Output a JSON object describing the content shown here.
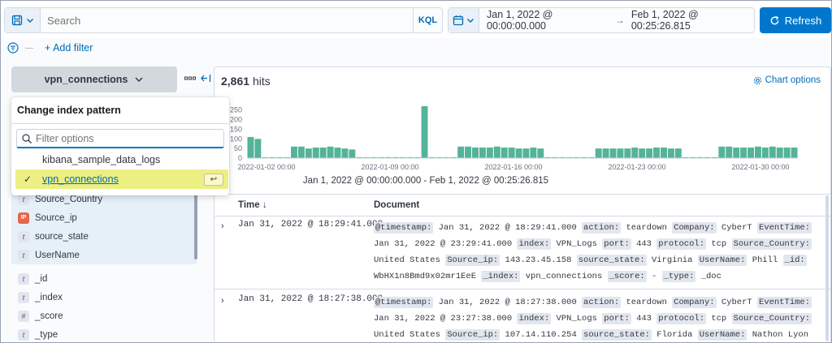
{
  "query_bar": {
    "placeholder": "Search",
    "language_label": "KQL",
    "saved_query_icon": "save-icon"
  },
  "date_picker": {
    "start": "Jan 1, 2022 @ 00:00:00.000",
    "arrow": "→",
    "end": "Feb 1, 2022 @ 00:25:26.815",
    "icon": "calendar-icon"
  },
  "refresh_label": "Refresh",
  "add_filter_label": "+ Add filter",
  "index_pattern": {
    "selected": "vpn_connections",
    "popover": {
      "title": "Change index pattern",
      "filter_placeholder": "Filter options",
      "options": [
        {
          "label": "kibana_sample_data_logs",
          "selected": false
        },
        {
          "label": "vpn_connections",
          "selected": true
        }
      ],
      "enter_key": "↩"
    }
  },
  "fields": {
    "selected_group": [
      {
        "type": "t",
        "name": "Source_Country"
      },
      {
        "type": "IP",
        "name": "Source_ip"
      },
      {
        "type": "t",
        "name": "source_state"
      },
      {
        "type": "t",
        "name": "UserName"
      }
    ],
    "meta": [
      {
        "type": "t",
        "name": "_id"
      },
      {
        "type": "t",
        "name": "_index"
      },
      {
        "type": "#",
        "name": "_score"
      },
      {
        "type": "t",
        "name": "_type"
      }
    ]
  },
  "hits": {
    "count": "2,861",
    "label": "hits"
  },
  "chart_options_label": "Chart options",
  "chart_range_label": "Jan 1, 2022 @ 00:00:00.000 - Feb 1, 2022 @ 00:25:26.815",
  "chart_data": {
    "type": "bar",
    "color": "#54b399",
    "y_ticks": [
      "250",
      "200",
      "150",
      "100",
      "50",
      "0"
    ],
    "ylim": [
      0,
      270
    ],
    "x_ticks": [
      "2022-01-02 00:00",
      "2022-01-09 00:00",
      "2022-01-16 00:00",
      "2022-01-23 00:00",
      "2022-01-30 00:00"
    ],
    "values": [
      110,
      100,
      5,
      5,
      5,
      5,
      60,
      60,
      50,
      55,
      55,
      60,
      55,
      50,
      45,
      5,
      5,
      5,
      5,
      5,
      5,
      5,
      5,
      5,
      270,
      5,
      5,
      5,
      5,
      60,
      60,
      55,
      55,
      55,
      60,
      55,
      55,
      50,
      50,
      55,
      50,
      5,
      5,
      5,
      5,
      5,
      5,
      5,
      50,
      50,
      50,
      50,
      50,
      55,
      50,
      50,
      55,
      55,
      50,
      50,
      5,
      5,
      5,
      5,
      5,
      60,
      60,
      55,
      55,
      55,
      60,
      55,
      60,
      55,
      55,
      55
    ]
  },
  "table": {
    "col_time": "Time ↓",
    "col_document": "Document",
    "rows": [
      {
        "time": "Jan 31, 2022 @ 18:29:41.000",
        "fields": [
          [
            "@timestamp:",
            "Jan 31, 2022 @ 18:29:41.000"
          ],
          [
            "action:",
            "teardown"
          ],
          [
            "Company:",
            "CyberT"
          ],
          [
            "EventTime:",
            "Jan 31, 2022 @ 23:29:41.000"
          ],
          [
            "index:",
            "VPN_Logs"
          ],
          [
            "port:",
            "443"
          ],
          [
            "protocol:",
            "tcp"
          ],
          [
            "Source_Country:",
            "United States"
          ],
          [
            "Source_ip:",
            "143.23.45.158"
          ],
          [
            "source_state:",
            "Virginia"
          ],
          [
            "UserName:",
            "Phill"
          ],
          [
            "_id:",
            "WbHX1n8Bmd9x02mr1EeE"
          ],
          [
            "_index:",
            "vpn_connections"
          ],
          [
            "_score:",
            " - "
          ],
          [
            "_type:",
            "_doc"
          ]
        ]
      },
      {
        "time": "Jan 31, 2022 @ 18:27:38.000",
        "fields": [
          [
            "@timestamp:",
            "Jan 31, 2022 @ 18:27:38.000"
          ],
          [
            "action:",
            "teardown"
          ],
          [
            "Company:",
            "CyberT"
          ],
          [
            "EventTime:",
            "Jan 31, 2022 @ 23:27:38.000"
          ],
          [
            "index:",
            "VPN_Logs"
          ],
          [
            "port:",
            "443"
          ],
          [
            "protocol:",
            "tcp"
          ],
          [
            "Source_Country:",
            "United States"
          ],
          [
            "Source_ip:",
            "107.14.110.254"
          ],
          [
            "source_state:",
            "Florida"
          ],
          [
            "UserName:",
            "Nathon Lyon"
          ]
        ]
      }
    ]
  }
}
